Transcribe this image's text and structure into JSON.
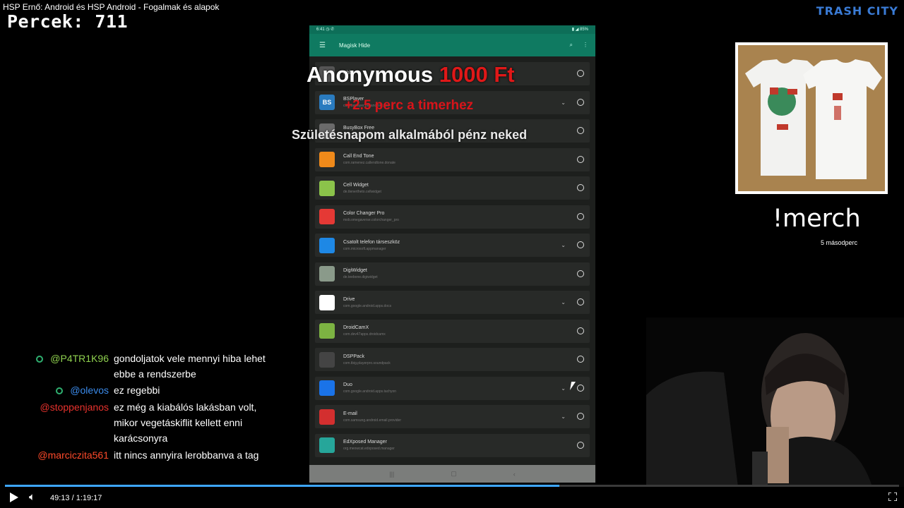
{
  "video": {
    "title": "HSP Ernő: Android és HSP Android - Fogalmak és alapok",
    "brand": "TRASH CITY",
    "counter": "Percek: 711"
  },
  "phone": {
    "status_left": "6:41 ◷ ✆",
    "status_right": "▮ ◢ 85%",
    "toolbar_title": "Magisk Hide",
    "apps": [
      {
        "name": "Abby",
        "pkg": "",
        "icon_color": "#555555",
        "chevron": false
      },
      {
        "name": "BSPlayer",
        "pkg": "com.bsplayer.bspandroid.free",
        "icon_color": "#2a7bbf",
        "icon_text": "BS",
        "chevron": true
      },
      {
        "name": "BusyBox Free",
        "pkg": "stericson.busybox",
        "icon_color": "#6b6b6b",
        "chevron": false
      },
      {
        "name": "Call End Tone",
        "pkg": "com.ramenez.callendtone.donate",
        "icon_color": "#f08a1a",
        "chevron": false
      },
      {
        "name": "Cell Widget",
        "pkg": "de.tlenertheto.cellwidget",
        "icon_color": "#8bc34a",
        "chevron": false
      },
      {
        "name": "Color Changer Pro",
        "pkg": "mob.omegaverse.colorchanger_pro",
        "icon_color": "#e53935",
        "chevron": false
      },
      {
        "name": "Csatolt telefon társeszköz",
        "pkg": "com.microsoft.appmanager",
        "icon_color": "#1e88e5",
        "chevron": true
      },
      {
        "name": "DigiWidget",
        "pkg": "de.teebone.digiwidget",
        "icon_color": "#8a9a8a",
        "chevron": false
      },
      {
        "name": "Drive",
        "pkg": "com.google.android.apps.docs",
        "icon_color": "#ffffff",
        "chevron": true
      },
      {
        "name": "DroidCamX",
        "pkg": "com.dev47apps.droidcamx",
        "icon_color": "#7cb342",
        "chevron": false
      },
      {
        "name": "DSPPack",
        "pkg": "com.tbig.playerpro.soundpack",
        "icon_color": "#444444",
        "chevron": false
      },
      {
        "name": "Duo",
        "pkg": "com.google.android.apps.tachyon",
        "icon_color": "#1a73e8",
        "chevron": true
      },
      {
        "name": "E-mail",
        "pkg": "com.samsung.android.email.provider",
        "icon_color": "#d32f2f",
        "chevron": true
      },
      {
        "name": "EdXposed Manager",
        "pkg": "org.meowcat.edxposed.manager",
        "icon_color": "#26a69a",
        "chevron": false
      }
    ]
  },
  "donation": {
    "name": "Anonymous",
    "amount": "1000 Ft",
    "bonus": "+2.5 perc a timerhez",
    "message": "Születésnapom alkalmából pénz neked"
  },
  "merch": {
    "command": "!merch",
    "timer": "5 másodperc"
  },
  "chat": [
    {
      "user": "@P4TR1K96",
      "user_color": "#8fd14f",
      "badge": true,
      "lines": [
        "gondoljatok vele mennyi hiba lehet",
        "ebbe a rendszerbe"
      ]
    },
    {
      "user": "@olevos",
      "user_color": "#3b8beb",
      "badge": true,
      "lines": [
        "ez regebbi"
      ]
    },
    {
      "user": "@stoppenjanos",
      "user_color": "#e8322d",
      "badge": false,
      "lines": [
        "ez még a kiabálós lakásban volt,",
        "mikor vegetáskiflit kellett enni",
        "karácsonyra"
      ]
    },
    {
      "user": "@marciczita561",
      "user_color": "#ff4a2a",
      "badge": false,
      "lines": [
        "itt nincs annyira lerobbanva a tag"
      ]
    }
  ],
  "player": {
    "time": "49:13 / 1:19:17",
    "progress_fraction": 0.62
  },
  "icons": {
    "play": "play-icon",
    "volume": "volume-icon",
    "fullscreen": "fullscreen-icon"
  }
}
